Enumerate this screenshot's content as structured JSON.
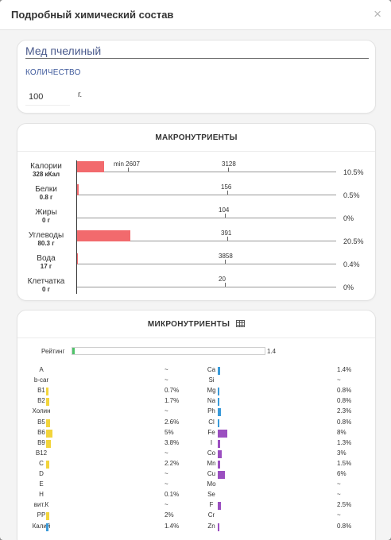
{
  "modal": {
    "title": "Подробный химический состав",
    "close": "×"
  },
  "food": {
    "name": "Мед пчелиный",
    "quantity_label": "КОЛИЧЕСТВО",
    "quantity_value": "100",
    "quantity_unit": "г."
  },
  "macros": {
    "title": "МАКРОНУТРИЕНТЫ",
    "rows": [
      {
        "name": "Калории",
        "amount": "328 кКал",
        "norm_label": "3128",
        "min_label": "min 2607",
        "percent": "10.5%",
        "fill_fraction": 0.105
      },
      {
        "name": "Белки",
        "amount": "0.8 г",
        "norm_label": "156",
        "percent": "0.5%",
        "fill_fraction": 0.005
      },
      {
        "name": "Жиры",
        "amount": "0 г",
        "norm_label": "104",
        "percent": "0%",
        "fill_fraction": 0
      },
      {
        "name": "Углеводы",
        "amount": "80.3 г",
        "norm_label": "391",
        "percent": "20.5%",
        "fill_fraction": 0.205
      },
      {
        "name": "Вода",
        "amount": "17 г",
        "norm_label": "3858",
        "percent": "0.4%",
        "fill_fraction": 0.004
      },
      {
        "name": "Клетчатка",
        "amount": "0 г",
        "norm_label": "20",
        "percent": "0%",
        "fill_fraction": 0
      }
    ]
  },
  "micros": {
    "title": "МИКРОНУТРИЕНТЫ",
    "rating_label": "Рейтинг",
    "rating_value": "1.4",
    "rating_fraction": 0.014,
    "vitamins": [
      {
        "name": "A",
        "value": "~",
        "color": "",
        "level": 0
      },
      {
        "name": "b-car",
        "value": "~",
        "color": "",
        "level": 0
      },
      {
        "name": "B1",
        "value": "0.7%",
        "color": "#f2d43c",
        "level": 0.3
      },
      {
        "name": "B2",
        "value": "1.7%",
        "color": "#f2d43c",
        "level": 0.4
      },
      {
        "name": "Холин",
        "value": "~",
        "color": "",
        "level": 0
      },
      {
        "name": "B5",
        "value": "2.6%",
        "color": "#f2d43c",
        "level": 0.45
      },
      {
        "name": "B6",
        "value": "5%",
        "color": "#f2d43c",
        "level": 0.8
      },
      {
        "name": "B9",
        "value": "3.8%",
        "color": "#f2d43c",
        "level": 0.6
      },
      {
        "name": "B12",
        "value": "~",
        "color": "",
        "level": 0
      },
      {
        "name": "C",
        "value": "2.2%",
        "color": "#f2d43c",
        "level": 0.4
      },
      {
        "name": "D",
        "value": "~",
        "color": "",
        "level": 0
      },
      {
        "name": "E",
        "value": "~",
        "color": "",
        "level": 0
      },
      {
        "name": "H",
        "value": "0.1%",
        "color": "",
        "level": 0
      },
      {
        "name": "вит.К",
        "value": "~",
        "color": "",
        "level": 0
      },
      {
        "name": "PP",
        "value": "2%",
        "color": "#f2d43c",
        "level": 0.35
      },
      {
        "name": "Калий",
        "value": "1.4%",
        "color": "#3a9ad9",
        "level": 0.3
      }
    ],
    "minerals": [
      {
        "name": "Ca",
        "value": "1.4%",
        "color": "#3a9ad9",
        "level": 0.3
      },
      {
        "name": "Si",
        "value": "~",
        "color": "",
        "level": 0
      },
      {
        "name": "Mg",
        "value": "0.8%",
        "color": "#3a9ad9",
        "level": 0.2
      },
      {
        "name": "Na",
        "value": "0.8%",
        "color": "#3a9ad9",
        "level": 0.2
      },
      {
        "name": "Ph",
        "value": "2.3%",
        "color": "#3a9ad9",
        "level": 0.4
      },
      {
        "name": "Cl",
        "value": "0.8%",
        "color": "#3a9ad9",
        "level": 0.2
      },
      {
        "name": "Fe",
        "value": "8%",
        "color": "#9b4fc0",
        "level": 1.2
      },
      {
        "name": "I",
        "value": "1.3%",
        "color": "#9b4fc0",
        "level": 0.3
      },
      {
        "name": "Co",
        "value": "3%",
        "color": "#9b4fc0",
        "level": 0.5
      },
      {
        "name": "Mn",
        "value": "1.5%",
        "color": "#9b4fc0",
        "level": 0.3
      },
      {
        "name": "Cu",
        "value": "6%",
        "color": "#9b4fc0",
        "level": 0.9
      },
      {
        "name": "Mo",
        "value": "~",
        "color": "",
        "level": 0
      },
      {
        "name": "Se",
        "value": "~",
        "color": "",
        "level": 0
      },
      {
        "name": "F",
        "value": "2.5%",
        "color": "#9b4fc0",
        "level": 0.4
      },
      {
        "name": "Cr",
        "value": "~",
        "color": "",
        "level": 0
      },
      {
        "name": "Zn",
        "value": "0.8%",
        "color": "#9b4fc0",
        "level": 0.2
      }
    ]
  }
}
